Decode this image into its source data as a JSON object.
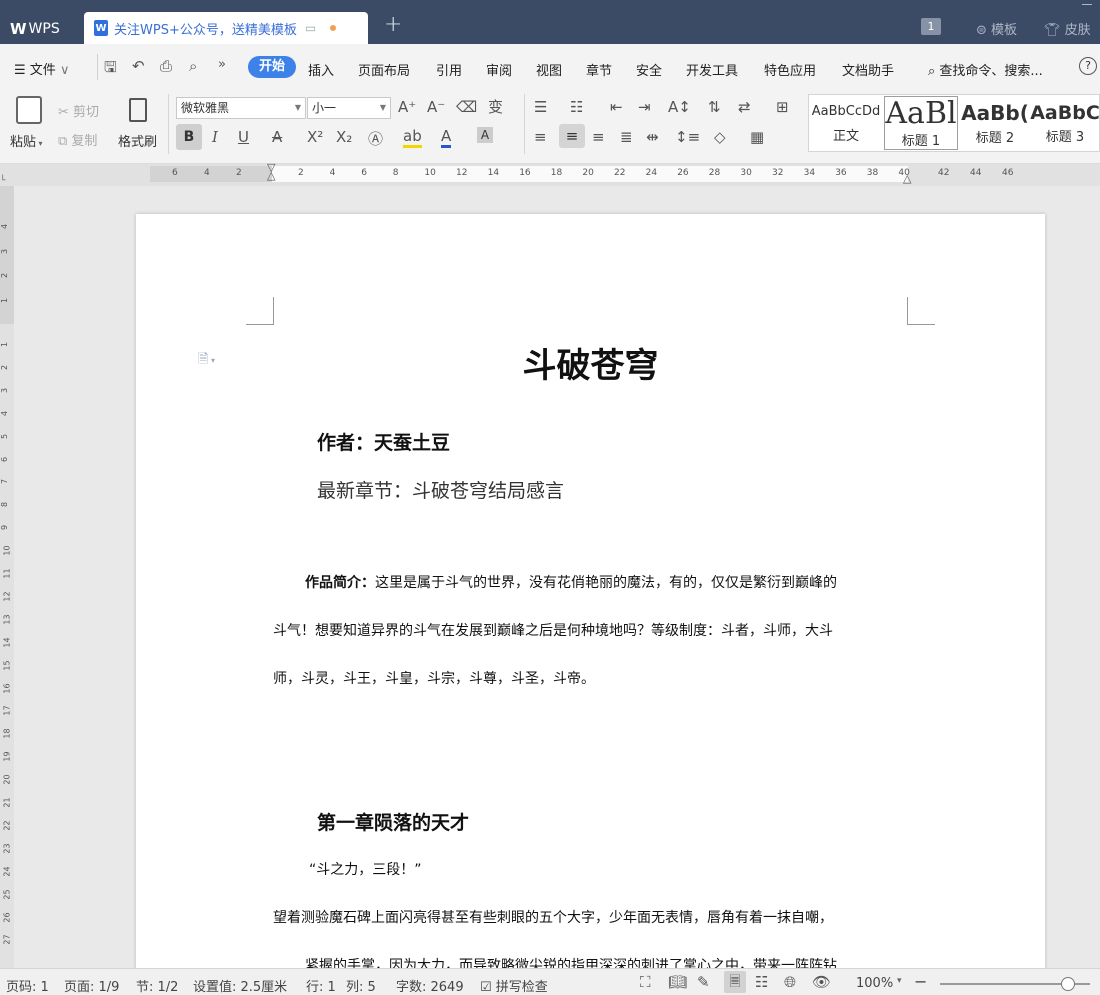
{
  "titlebar": {
    "app_tab": "WPS",
    "doc_tab_title": "关注WPS+公众号，送精美模板",
    "new_tab": "+",
    "page_count_badge": "1",
    "templates": "模板",
    "skin": "皮肤"
  },
  "menu": {
    "file": "文件",
    "items": [
      "开始",
      "插入",
      "页面布局",
      "引用",
      "审阅",
      "视图",
      "章节",
      "安全",
      "开发工具",
      "特色应用",
      "文档助手"
    ],
    "search": "查找命令、搜索...",
    "help": "?"
  },
  "ribbon": {
    "paste": "粘贴",
    "cut": "剪切",
    "copy": "复制",
    "format_painter": "格式刷",
    "font_name": "微软雅黑",
    "font_size": "小一",
    "styles": [
      {
        "preview": "AaBbCcDd",
        "label": "正文"
      },
      {
        "preview": "AaBl",
        "label": "标题 1"
      },
      {
        "preview": "AaBb(",
        "label": "标题 2"
      },
      {
        "preview": "AaBbC",
        "label": "标题 3"
      }
    ]
  },
  "ruler": {
    "left_ticks": [
      "6",
      "4",
      "2"
    ],
    "ticks": [
      "2",
      "4",
      "6",
      "8",
      "10",
      "12",
      "14",
      "16",
      "18",
      "20",
      "22",
      "24",
      "26",
      "28",
      "30",
      "32",
      "34",
      "36",
      "38",
      "40"
    ],
    "right_ticks": [
      "42",
      "44",
      "46"
    ],
    "vertical_top": [
      "4",
      "3",
      "2",
      "1"
    ],
    "vertical": [
      "1",
      "2",
      "3",
      "4",
      "5",
      "6",
      "7",
      "8",
      "9",
      "10",
      "11",
      "12",
      "13",
      "14",
      "15",
      "16",
      "17",
      "18",
      "19",
      "20",
      "21",
      "22",
      "23",
      "24",
      "25",
      "26",
      "27"
    ]
  },
  "document": {
    "title": "斗破苍穹",
    "author": "作者：天蚕土豆",
    "latest": "最新章节：斗破苍穹结局感言",
    "intro_label": "作品简介：",
    "intro_line1": "这里是属于斗气的世界，没有花俏艳丽的魔法，有的，仅仅是繁衍到巅峰的",
    "intro_line2": "斗气！想要知道异界的斗气在发展到巅峰之后是何种境地吗？等级制度：斗者，斗师，大斗",
    "intro_line3": "师，斗灵，斗王，斗皇，斗宗，斗尊，斗圣，斗帝。",
    "chapter_title": "第一章陨落的天才",
    "quote": "“斗之力，三段！”",
    "para_line1": "望着测验魔石碑上面闪亮得甚至有些刺眼的五个大字，少年面无表情，唇角有着一抹自嘲，",
    "para_line2": "紧握的手掌，因为大力，而导致略微尖锐的指甲深深的刺进了掌心之中，带来一阵阵钻"
  },
  "status": {
    "page_code": "页码: 1",
    "page": "页面: 1/9",
    "section": "节: 1/2",
    "setting": "设置值: 2.5厘米",
    "row": "行: 1",
    "col": "列: 5",
    "wordcount": "字数: 2649",
    "spellcheck": "拼写检查",
    "zoom": "100%",
    "zoom_level": 0.85
  }
}
